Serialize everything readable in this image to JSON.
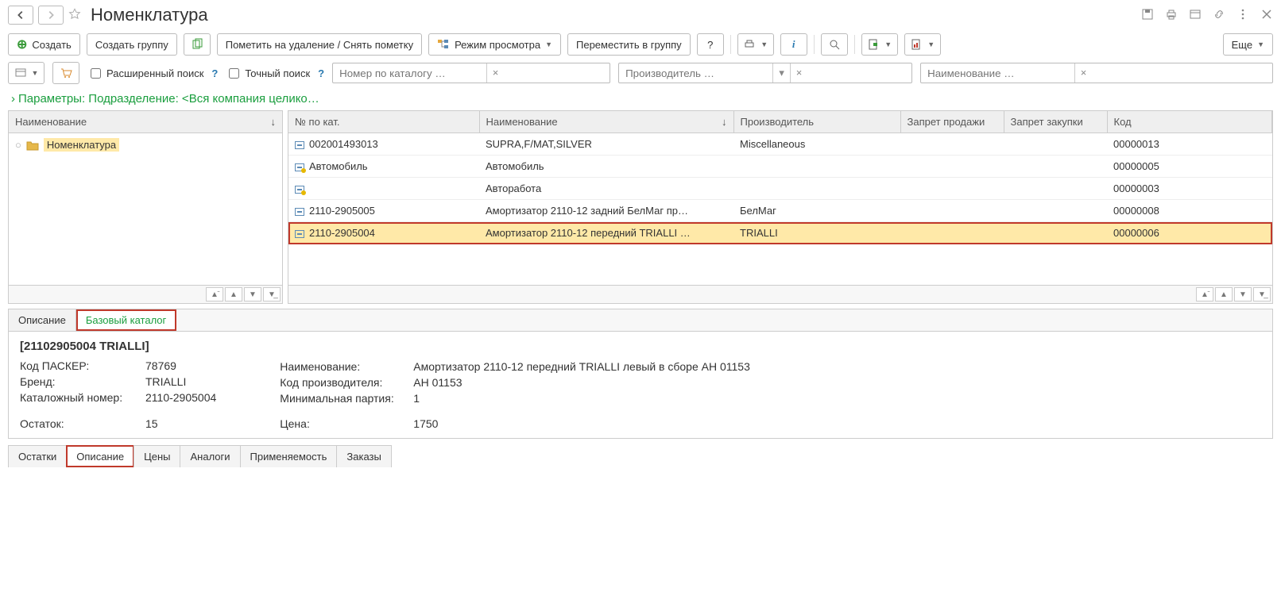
{
  "titlebar": {
    "title": "Номенклатура"
  },
  "toolbar": {
    "create": "Создать",
    "create_group": "Создать группу",
    "mark_delete": "Пометить на удаление / Снять пометку",
    "view_mode": "Режим просмотра",
    "move_to_group": "Переместить в группу",
    "help": "?",
    "more": "Еще"
  },
  "search": {
    "ext": "Расширенный поиск",
    "exact": "Точный поиск",
    "catalog_ph": "Номер по каталогу …",
    "maker_ph": "Производитель …",
    "name_ph": "Наименование …"
  },
  "params_line": "Параметры: Подразделение: <Вся компания целико…",
  "tree": {
    "col": "Наименование",
    "root": "Номенклатура"
  },
  "table": {
    "cols": {
      "cat": "№ по кат.",
      "name": "Наименование",
      "maker": "Производитель",
      "nosell": "Запрет продажи",
      "nobuy": "Запрет закупки",
      "code": "Код"
    },
    "rows": [
      {
        "ic": "",
        "cat": "002001493013",
        "name": "SUPRA,F/MAT,SILVER",
        "maker": "Miscellaneous",
        "code": "00000013"
      },
      {
        "ic": "y",
        "cat": "Автомобиль",
        "name": "Автомобиль",
        "maker": "",
        "code": "00000005"
      },
      {
        "ic": "y",
        "cat": "",
        "name": "Авторабота",
        "maker": "",
        "code": "00000003"
      },
      {
        "ic": "",
        "cat": "2110-2905005",
        "name": "Амортизатор 2110-12 задний БелМаг пр…",
        "maker": "БелМаг",
        "code": "00000008"
      },
      {
        "ic": "",
        "cat": "2110-2905004",
        "name": "Амортизатор 2110-12 передний TRIALLI …",
        "maker": "TRIALLI",
        "code": "00000006",
        "sel": true
      }
    ]
  },
  "detail_tabs": {
    "t1": "Описание",
    "t2": "Базовый каталог"
  },
  "detail": {
    "header": "[21102905004 TRIALLI]",
    "l1k": "Код ПАСКЕР:",
    "l1v": "78769",
    "l2k": "Бренд:",
    "l2v": "TRIALLI",
    "l3k": "Каталожный номер:",
    "l3v": "2110-2905004",
    "l4k": "Остаток:",
    "l4v": "15",
    "r1k": "Наименование:",
    "r1v": "Амортизатор 2110-12 передний TRIALLI левый в сборе AH 01153",
    "r2k": "Код производителя:",
    "r2v": "AH 01153",
    "r3k": "Минимальная партия:",
    "r3v": "1",
    "r4k": "Цена:",
    "r4v": "1750"
  },
  "bottom_tabs": {
    "t1": "Остатки",
    "t2": "Описание",
    "t3": "Цены",
    "t4": "Аналоги",
    "t5": "Применяемость",
    "t6": "Заказы"
  }
}
